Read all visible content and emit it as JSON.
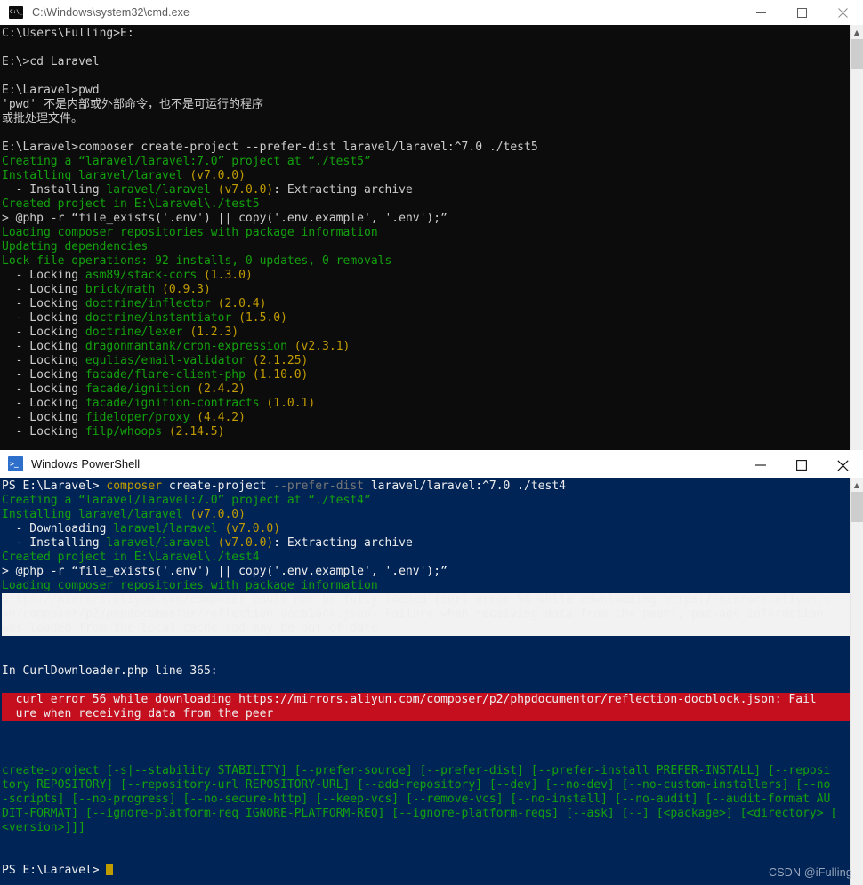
{
  "cmd_window": {
    "title": "C:\\Windows\\system32\\cmd.exe",
    "icon": "cmd-icon",
    "controls": {
      "minimize": "—",
      "maximize": "□",
      "close": "✕"
    },
    "lines": [
      {
        "segs": [
          {
            "t": "C:\\Users\\Fulling>E:",
            "c": "w"
          }
        ]
      },
      {
        "segs": []
      },
      {
        "segs": [
          {
            "t": "E:\\>cd Laravel",
            "c": "w"
          }
        ]
      },
      {
        "segs": []
      },
      {
        "segs": [
          {
            "t": "E:\\Laravel>pwd",
            "c": "w"
          }
        ]
      },
      {
        "segs": [
          {
            "t": "'pwd' 不是内部或外部命令，也不是可运行的程序",
            "c": "w"
          }
        ]
      },
      {
        "segs": [
          {
            "t": "或批处理文件。",
            "c": "w"
          }
        ]
      },
      {
        "segs": []
      },
      {
        "segs": [
          {
            "t": "E:\\Laravel>composer create-project --prefer-dist laravel/laravel:^7.0 ./test5",
            "c": "w"
          }
        ]
      },
      {
        "segs": [
          {
            "t": "Creating a “laravel/laravel:7.0” project at “./test5”",
            "c": "g"
          }
        ]
      },
      {
        "segs": [
          {
            "t": "Installing laravel/laravel ",
            "c": "g"
          },
          {
            "t": "(v7.0.0)",
            "c": "y"
          }
        ]
      },
      {
        "segs": [
          {
            "t": "  - Installing ",
            "c": "w"
          },
          {
            "t": "laravel/laravel ",
            "c": "g"
          },
          {
            "t": "(v7.0.0)",
            "c": "y"
          },
          {
            "t": ": Extracting archive",
            "c": "w"
          }
        ]
      },
      {
        "segs": [
          {
            "t": "Created project in E:\\Laravel\\./test5",
            "c": "g"
          }
        ]
      },
      {
        "segs": [
          {
            "t": "> @php -r “file_exists('.env') || copy('.env.example', '.env');”",
            "c": "w"
          }
        ]
      },
      {
        "segs": [
          {
            "t": "Loading composer repositories with package information",
            "c": "g"
          }
        ]
      },
      {
        "segs": [
          {
            "t": "Updating dependencies",
            "c": "g"
          }
        ]
      },
      {
        "segs": [
          {
            "t": "Lock file operations: 92 installs, 0 updates, 0 removals",
            "c": "g"
          }
        ]
      },
      {
        "segs": [
          {
            "t": "  - Locking ",
            "c": "w"
          },
          {
            "t": "asm89/stack-cors ",
            "c": "g"
          },
          {
            "t": "(1.3.0)",
            "c": "y"
          }
        ]
      },
      {
        "segs": [
          {
            "t": "  - Locking ",
            "c": "w"
          },
          {
            "t": "brick/math ",
            "c": "g"
          },
          {
            "t": "(0.9.3)",
            "c": "y"
          }
        ]
      },
      {
        "segs": [
          {
            "t": "  - Locking ",
            "c": "w"
          },
          {
            "t": "doctrine/inflector ",
            "c": "g"
          },
          {
            "t": "(2.0.4)",
            "c": "y"
          }
        ]
      },
      {
        "segs": [
          {
            "t": "  - Locking ",
            "c": "w"
          },
          {
            "t": "doctrine/instantiator ",
            "c": "g"
          },
          {
            "t": "(1.5.0)",
            "c": "y"
          }
        ]
      },
      {
        "segs": [
          {
            "t": "  - Locking ",
            "c": "w"
          },
          {
            "t": "doctrine/lexer ",
            "c": "g"
          },
          {
            "t": "(1.2.3)",
            "c": "y"
          }
        ]
      },
      {
        "segs": [
          {
            "t": "  - Locking ",
            "c": "w"
          },
          {
            "t": "dragonmantank/cron-expression ",
            "c": "g"
          },
          {
            "t": "(v2.3.1)",
            "c": "y"
          }
        ]
      },
      {
        "segs": [
          {
            "t": "  - Locking ",
            "c": "w"
          },
          {
            "t": "egulias/email-validator ",
            "c": "g"
          },
          {
            "t": "(2.1.25)",
            "c": "y"
          }
        ]
      },
      {
        "segs": [
          {
            "t": "  - Locking ",
            "c": "w"
          },
          {
            "t": "facade/flare-client-php ",
            "c": "g"
          },
          {
            "t": "(1.10.0)",
            "c": "y"
          }
        ]
      },
      {
        "segs": [
          {
            "t": "  - Locking ",
            "c": "w"
          },
          {
            "t": "facade/ignition ",
            "c": "g"
          },
          {
            "t": "(2.4.2)",
            "c": "y"
          }
        ]
      },
      {
        "segs": [
          {
            "t": "  - Locking ",
            "c": "w"
          },
          {
            "t": "facade/ignition-contracts ",
            "c": "g"
          },
          {
            "t": "(1.0.1)",
            "c": "y"
          }
        ]
      },
      {
        "segs": [
          {
            "t": "  - Locking ",
            "c": "w"
          },
          {
            "t": "fideloper/proxy ",
            "c": "g"
          },
          {
            "t": "(4.4.2)",
            "c": "y"
          }
        ]
      },
      {
        "segs": [
          {
            "t": "  - Locking ",
            "c": "w"
          },
          {
            "t": "filp/whoops ",
            "c": "g"
          },
          {
            "t": "(2.14.5)",
            "c": "y"
          }
        ]
      }
    ]
  },
  "ps_window": {
    "title": "Windows PowerShell",
    "icon": "powershell-icon",
    "controls": {
      "minimize": "—",
      "maximize": "□",
      "close": "✕"
    },
    "lines": [
      {
        "segs": [
          {
            "t": "PS E:\\Laravel> ",
            "c": "psw"
          },
          {
            "t": "composer ",
            "c": "ylw"
          },
          {
            "t": "create-project ",
            "c": "psw"
          },
          {
            "t": "--prefer-dist ",
            "c": "gy"
          },
          {
            "t": "laravel/laravel:^7.0 ./test4",
            "c": "psw"
          }
        ]
      },
      {
        "segs": [
          {
            "t": "Creating a “laravel/laravel:7.0” project at “./test4”",
            "c": "g"
          }
        ]
      },
      {
        "segs": [
          {
            "t": "Installing laravel/laravel ",
            "c": "g"
          },
          {
            "t": "(v7.0.0)",
            "c": "y"
          }
        ]
      },
      {
        "segs": [
          {
            "t": "  - Downloading ",
            "c": "psw"
          },
          {
            "t": "laravel/laravel ",
            "c": "g"
          },
          {
            "t": "(v7.0.0)",
            "c": "y"
          }
        ]
      },
      {
        "segs": [
          {
            "t": "  - Installing ",
            "c": "psw"
          },
          {
            "t": "laravel/laravel ",
            "c": "g"
          },
          {
            "t": "(v7.0.0)",
            "c": "y"
          },
          {
            "t": ": Extracting archive",
            "c": "psw"
          }
        ]
      },
      {
        "segs": [
          {
            "t": "Created project in E:\\Laravel\\./test4",
            "c": "g"
          }
        ]
      },
      {
        "segs": [
          {
            "t": "> @php -r “file_exists('.env') || copy('.env.example', '.env');”",
            "c": "psw"
          }
        ]
      },
      {
        "segs": [
          {
            "t": "Loading composer repositories with package information",
            "c": "g"
          }
        ]
      }
    ],
    "warning_block": [
      "https://mirrors.aliyun.com/composer could not be fully loaded (curl error 56 while downloading https://mirrors.aliyun.c",
      "om/composer/p2/phpdocumentor/reflection-docblock.json: Failure when receiving data from the peer), package information",
      "was loaded from the local cache and may be out of date"
    ],
    "exception_header": "In CurlDownloader.php line 365:",
    "error_block": [
      "  curl error 56 while downloading https://mirrors.aliyun.com/composer/p2/phpdocumentor/reflection-docblock.json: Fail",
      "  ure when receiving data from the peer"
    ],
    "usage_block": [
      "create-project [-s|--stability STABILITY] [--prefer-source] [--prefer-dist] [--prefer-install PREFER-INSTALL] [--reposi",
      "tory REPOSITORY] [--repository-url REPOSITORY-URL] [--add-repository] [--dev] [--no-dev] [--no-custom-installers] [--no",
      "-scripts] [--no-progress] [--no-secure-http] [--keep-vcs] [--remove-vcs] [--no-install] [--no-audit] [--audit-format AU",
      "DIT-FORMAT] [--ignore-platform-req IGNORE-PLATFORM-REQ] [--ignore-platform-reqs] [--ask] [--] [<package>] [<directory> [",
      "<version>]]]"
    ],
    "final_prompt": "PS E:\\Laravel> "
  },
  "watermark": "CSDN @iFulling"
}
